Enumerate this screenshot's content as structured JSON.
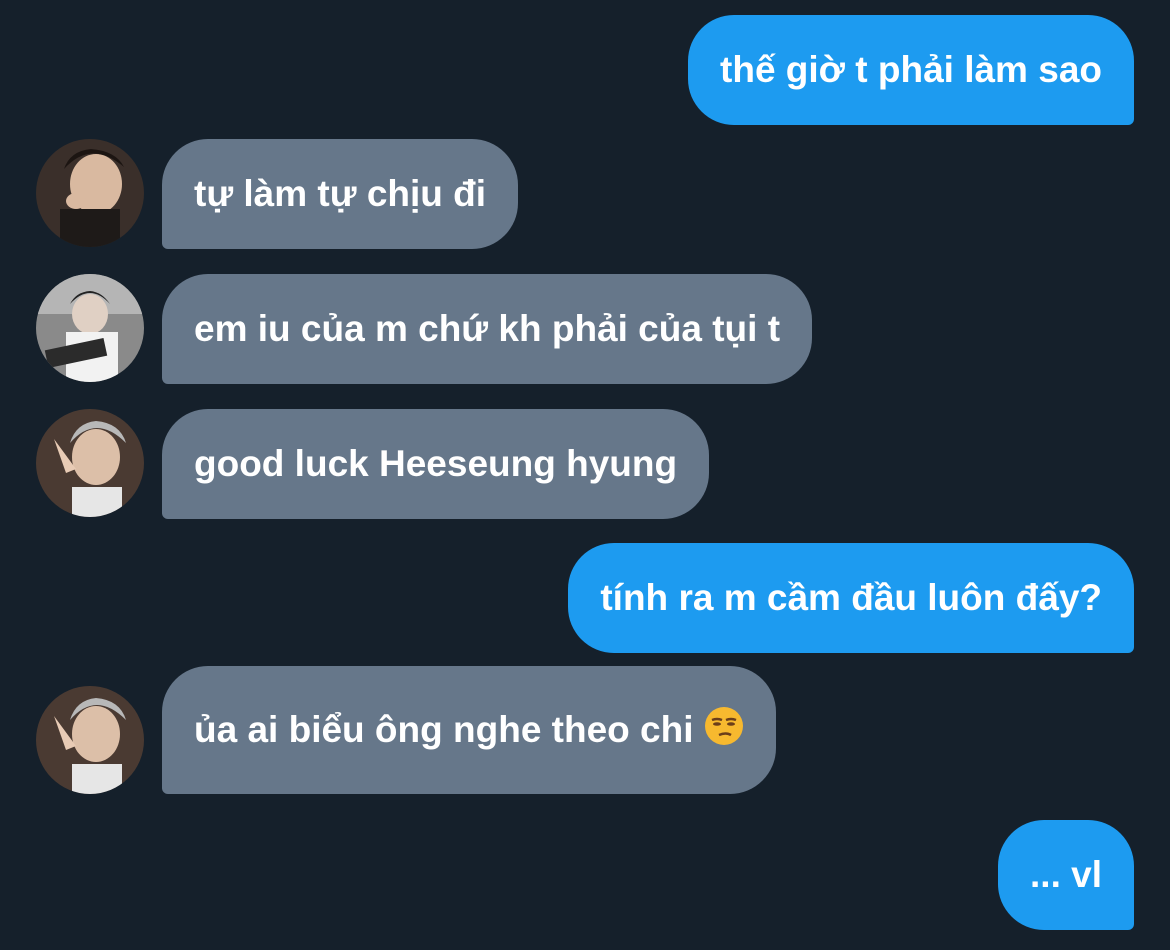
{
  "conversation": {
    "messages": [
      {
        "direction": "outgoing",
        "text": "thế giờ t phải làm sao"
      },
      {
        "direction": "incoming",
        "text": "tự làm tự chịu đi",
        "avatar": "avatar-1"
      },
      {
        "direction": "incoming",
        "text": "em iu của m chứ kh phải của tụi t",
        "avatar": "avatar-2"
      },
      {
        "direction": "incoming",
        "text": "good luck Heeseung hyung",
        "avatar": "avatar-3"
      },
      {
        "direction": "outgoing",
        "text": "tính ra m cầm đầu luôn đấy?"
      },
      {
        "direction": "incoming",
        "text": "ủa ai biểu ông nghe theo chi",
        "emoji": "😒",
        "avatar": "avatar-3"
      },
      {
        "direction": "outgoing",
        "text": "... vl"
      }
    ]
  },
  "colors": {
    "background": "#15202b",
    "outgoing_bubble": "#1d9bf0",
    "incoming_bubble": "#66778a",
    "text": "#ffffff"
  }
}
